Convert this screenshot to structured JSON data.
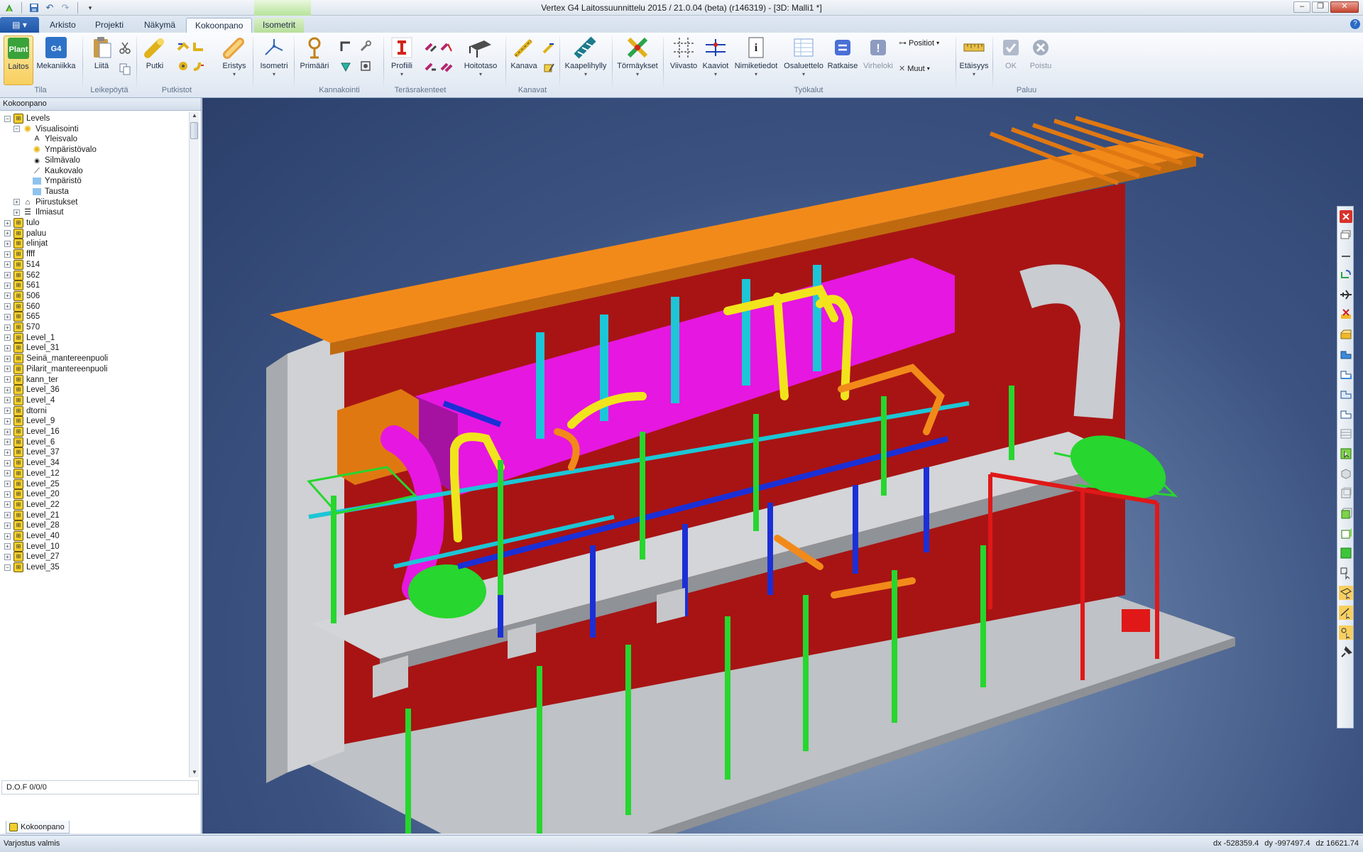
{
  "window": {
    "title": "Vertex G4 Laitossuunnittelu 2015 / 21.0.04 (beta) (r146319) - [3D: Malli1 *]",
    "minimize": "–",
    "restore": "❐",
    "close": "✕"
  },
  "ribbon_tabs": {
    "file": "▤ ▾",
    "arkisto": "Arkisto",
    "projekti": "Projekti",
    "nakyma": "Näkymä",
    "kokoonpano": "Kokoonpano",
    "isometrit": "Isometrit",
    "help": "?"
  },
  "ribbon": {
    "laitos": "Laitos",
    "laitos_badge": "Plant",
    "mekaniikka": "Mekaniikka",
    "mekaniikka_badge": "G4",
    "liita": "Liitä",
    "putki": "Putki",
    "eristys": "Eristys",
    "isometri": "Isometri",
    "primaari": "Primääri",
    "profiili": "Profiili",
    "hoitotaso": "Hoitotaso",
    "kanava": "Kanava",
    "kaapelihylly": "Kaapelihylly",
    "tormaykset": "Törmäykset",
    "viivasto": "Viivasto",
    "kaaviot": "Kaaviot",
    "nimiketiedot": "Nimiketiedot",
    "osaluettelo": "Osaluettelo",
    "ratkaise": "Ratkaise",
    "virheloki": "Virheloki",
    "positiot": "Positiot",
    "muut": "Muut",
    "etaisyys": "Etäisyys",
    "ok": "OK",
    "poistu": "Poistu",
    "groups": {
      "tila": "Tila",
      "leikepoyta": "Leikepöytä",
      "putkistot": "Putkistot",
      "kannakointi": "Kannakointi",
      "terasrakenteet": "Teräsrakenteet",
      "kanavat": "Kanavat",
      "tyokalut": "Työkalut",
      "paluu": "Paluu"
    }
  },
  "panel": {
    "title": "Kokoonpano",
    "dof": "D.O.F 0/0/0",
    "bottom_tab": "Kokoonpano"
  },
  "tree": [
    {
      "label": "Levels",
      "indent": 0,
      "icon": "level",
      "exp": "−"
    },
    {
      "label": "Visualisointi",
      "indent": 1,
      "icon": "sun",
      "exp": "−"
    },
    {
      "label": "Yleisvalo",
      "indent": 2,
      "icon": "a-letter",
      "exp": ""
    },
    {
      "label": "Ympäristövalo",
      "indent": 2,
      "icon": "sun",
      "exp": ""
    },
    {
      "label": "Silmävalo",
      "indent": 2,
      "icon": "eye",
      "exp": ""
    },
    {
      "label": "Kaukovalo",
      "indent": 2,
      "icon": "ray",
      "exp": ""
    },
    {
      "label": "Ympäristö",
      "indent": 2,
      "icon": "square",
      "exp": ""
    },
    {
      "label": "Tausta",
      "indent": 2,
      "icon": "square",
      "exp": ""
    },
    {
      "label": "Piirustukset",
      "indent": 1,
      "icon": "drawing",
      "exp": "+"
    },
    {
      "label": "Ilmiasut",
      "indent": 1,
      "icon": "list",
      "exp": "+"
    },
    {
      "label": "tulo",
      "indent": 0,
      "icon": "level",
      "exp": "+"
    },
    {
      "label": "paluu",
      "indent": 0,
      "icon": "level",
      "exp": "+"
    },
    {
      "label": "elinjat",
      "indent": 0,
      "icon": "level",
      "exp": "+"
    },
    {
      "label": "ffff",
      "indent": 0,
      "icon": "level",
      "exp": "+"
    },
    {
      "label": "514",
      "indent": 0,
      "icon": "level",
      "exp": "+"
    },
    {
      "label": "562",
      "indent": 0,
      "icon": "level",
      "exp": "+"
    },
    {
      "label": "561",
      "indent": 0,
      "icon": "level",
      "exp": "+"
    },
    {
      "label": "506",
      "indent": 0,
      "icon": "level",
      "exp": "+"
    },
    {
      "label": "560",
      "indent": 0,
      "icon": "level",
      "exp": "+"
    },
    {
      "label": "565",
      "indent": 0,
      "icon": "level",
      "exp": "+"
    },
    {
      "label": "570",
      "indent": 0,
      "icon": "level",
      "exp": "+"
    },
    {
      "label": "Level_1",
      "indent": 0,
      "icon": "level",
      "exp": "+"
    },
    {
      "label": "Level_31",
      "indent": 0,
      "icon": "level",
      "exp": "+"
    },
    {
      "label": "Seinä_mantereenpuoli",
      "indent": 0,
      "icon": "level",
      "exp": "+"
    },
    {
      "label": "Pilarit_mantereenpuoli",
      "indent": 0,
      "icon": "level",
      "exp": "+"
    },
    {
      "label": "kann_ter",
      "indent": 0,
      "icon": "level",
      "exp": "+"
    },
    {
      "label": "Level_36",
      "indent": 0,
      "icon": "level",
      "exp": "+"
    },
    {
      "label": "Level_4",
      "indent": 0,
      "icon": "level",
      "exp": "+"
    },
    {
      "label": "dtorni",
      "indent": 0,
      "icon": "level",
      "exp": "+"
    },
    {
      "label": "Level_9",
      "indent": 0,
      "icon": "level",
      "exp": "+"
    },
    {
      "label": "Level_16",
      "indent": 0,
      "icon": "level",
      "exp": "+"
    },
    {
      "label": "Level_6",
      "indent": 0,
      "icon": "level",
      "exp": "+"
    },
    {
      "label": "Level_37",
      "indent": 0,
      "icon": "level",
      "exp": "+"
    },
    {
      "label": "Level_34",
      "indent": 0,
      "icon": "level",
      "exp": "+"
    },
    {
      "label": "Level_12",
      "indent": 0,
      "icon": "level",
      "exp": "+"
    },
    {
      "label": "Level_25",
      "indent": 0,
      "icon": "level",
      "exp": "+"
    },
    {
      "label": "Level_20",
      "indent": 0,
      "icon": "level",
      "exp": "+"
    },
    {
      "label": "Level_22",
      "indent": 0,
      "icon": "level",
      "exp": "+"
    },
    {
      "label": "Level_21",
      "indent": 0,
      "icon": "level",
      "exp": "+"
    },
    {
      "label": "Level_28",
      "indent": 0,
      "icon": "level",
      "exp": "+"
    },
    {
      "label": "Level_40",
      "indent": 0,
      "icon": "level",
      "exp": "+"
    },
    {
      "label": "Level_10",
      "indent": 0,
      "icon": "level",
      "exp": "+"
    },
    {
      "label": "Level_27",
      "indent": 0,
      "icon": "level",
      "exp": "+"
    },
    {
      "label": "Level_35",
      "indent": 0,
      "icon": "level",
      "exp": "−"
    }
  ],
  "status": {
    "message": "Varjostus valmis",
    "dx": "dx -528359.4",
    "dy": "dy -997497.4",
    "dz": "dz 16621.74"
  },
  "colors": {
    "accent": "#2d6fc6",
    "steel_orange": "#f28a1a",
    "pipe_yellow": "#f2e41c",
    "duct_magenta": "#e617e0",
    "pipe_cyan": "#1cc6d6",
    "column_green": "#27d62e",
    "beam_blue": "#1b2fd6",
    "frame_red": "#e01818",
    "wall_red": "#b51212",
    "concrete": "#c7c9cc"
  }
}
